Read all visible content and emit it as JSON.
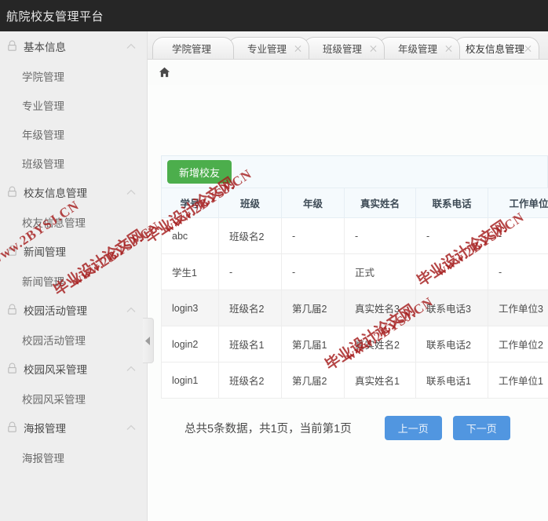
{
  "header": {
    "title": "航院校友管理平台"
  },
  "sidebar": {
    "groups": [
      {
        "label": "基本信息",
        "icon": "lock-icon",
        "chevron": "chevron-up-icon",
        "items": [
          "学院管理",
          "专业管理",
          "年级管理",
          "班级管理"
        ]
      },
      {
        "label": "校友信息管理",
        "icon": "lock-icon",
        "chevron": "chevron-up-icon",
        "items": [
          "校友信息管理"
        ]
      },
      {
        "label": "新闻管理",
        "icon": "lock-icon",
        "chevron": "",
        "items": [
          "新闻管理"
        ]
      },
      {
        "label": "校园活动管理",
        "icon": "lock-icon",
        "chevron": "chevron-up-icon",
        "items": [
          "校园活动管理"
        ]
      },
      {
        "label": "校园风采管理",
        "icon": "lock-icon",
        "chevron": "chevron-up-icon",
        "items": [
          "校园风采管理"
        ]
      },
      {
        "label": "海报管理",
        "icon": "lock-icon",
        "chevron": "chevron-up-icon",
        "items": [
          "海报管理"
        ]
      }
    ],
    "collapse_handle": "collapse-sidebar-arrow"
  },
  "tabs": [
    {
      "label": "学院管理",
      "closable": false,
      "active": false
    },
    {
      "label": "专业管理",
      "closable": true,
      "active": false
    },
    {
      "label": "班级管理",
      "closable": true,
      "active": false
    },
    {
      "label": "年级管理",
      "closable": true,
      "active": false
    },
    {
      "label": "校友信息管理",
      "closable": true,
      "active": true
    }
  ],
  "breadcrumb": {
    "home_icon": "home-icon"
  },
  "toolbar": {
    "add_label": "新增校友"
  },
  "table": {
    "columns": [
      "学号",
      "班级",
      "年级",
      "真实姓名",
      "联系电话",
      "工作单位",
      ""
    ],
    "rows": [
      {
        "hovered": false,
        "cells": [
          "abc",
          "班级名2",
          "-",
          "-",
          "-",
          "-",
          ""
        ]
      },
      {
        "hovered": false,
        "cells": [
          "学生1",
          "-",
          "-",
          "正式",
          "-",
          "-",
          ""
        ]
      },
      {
        "hovered": true,
        "cells": [
          "login3",
          "班级名2",
          "第几届2",
          "真实姓名3",
          "联系电话3",
          "工作单位3",
          ""
        ]
      },
      {
        "hovered": false,
        "cells": [
          "login2",
          "班级名1",
          "第几届1",
          "真实姓名2",
          "联系电话2",
          "工作单位2",
          ""
        ]
      },
      {
        "hovered": false,
        "cells": [
          "login1",
          "班级名2",
          "第几届2",
          "真实姓名1",
          "联系电话1",
          "工作单位1",
          ""
        ]
      }
    ]
  },
  "pagination": {
    "info": "总共5条数据，共1页，当前第1页",
    "prev_label": "上一页",
    "next_label": "下一页"
  },
  "watermarks": {
    "zh": "毕业设计论文网",
    "url": "www.2BYSJ.CN"
  },
  "colors": {
    "header_bg": "#262626",
    "sidebar_bg": "#eeeeee",
    "accent_green": "#4cae4c",
    "accent_blue": "#5196e0",
    "table_header_bg": "#f5fafd",
    "watermark_red": "#a51d1d"
  }
}
